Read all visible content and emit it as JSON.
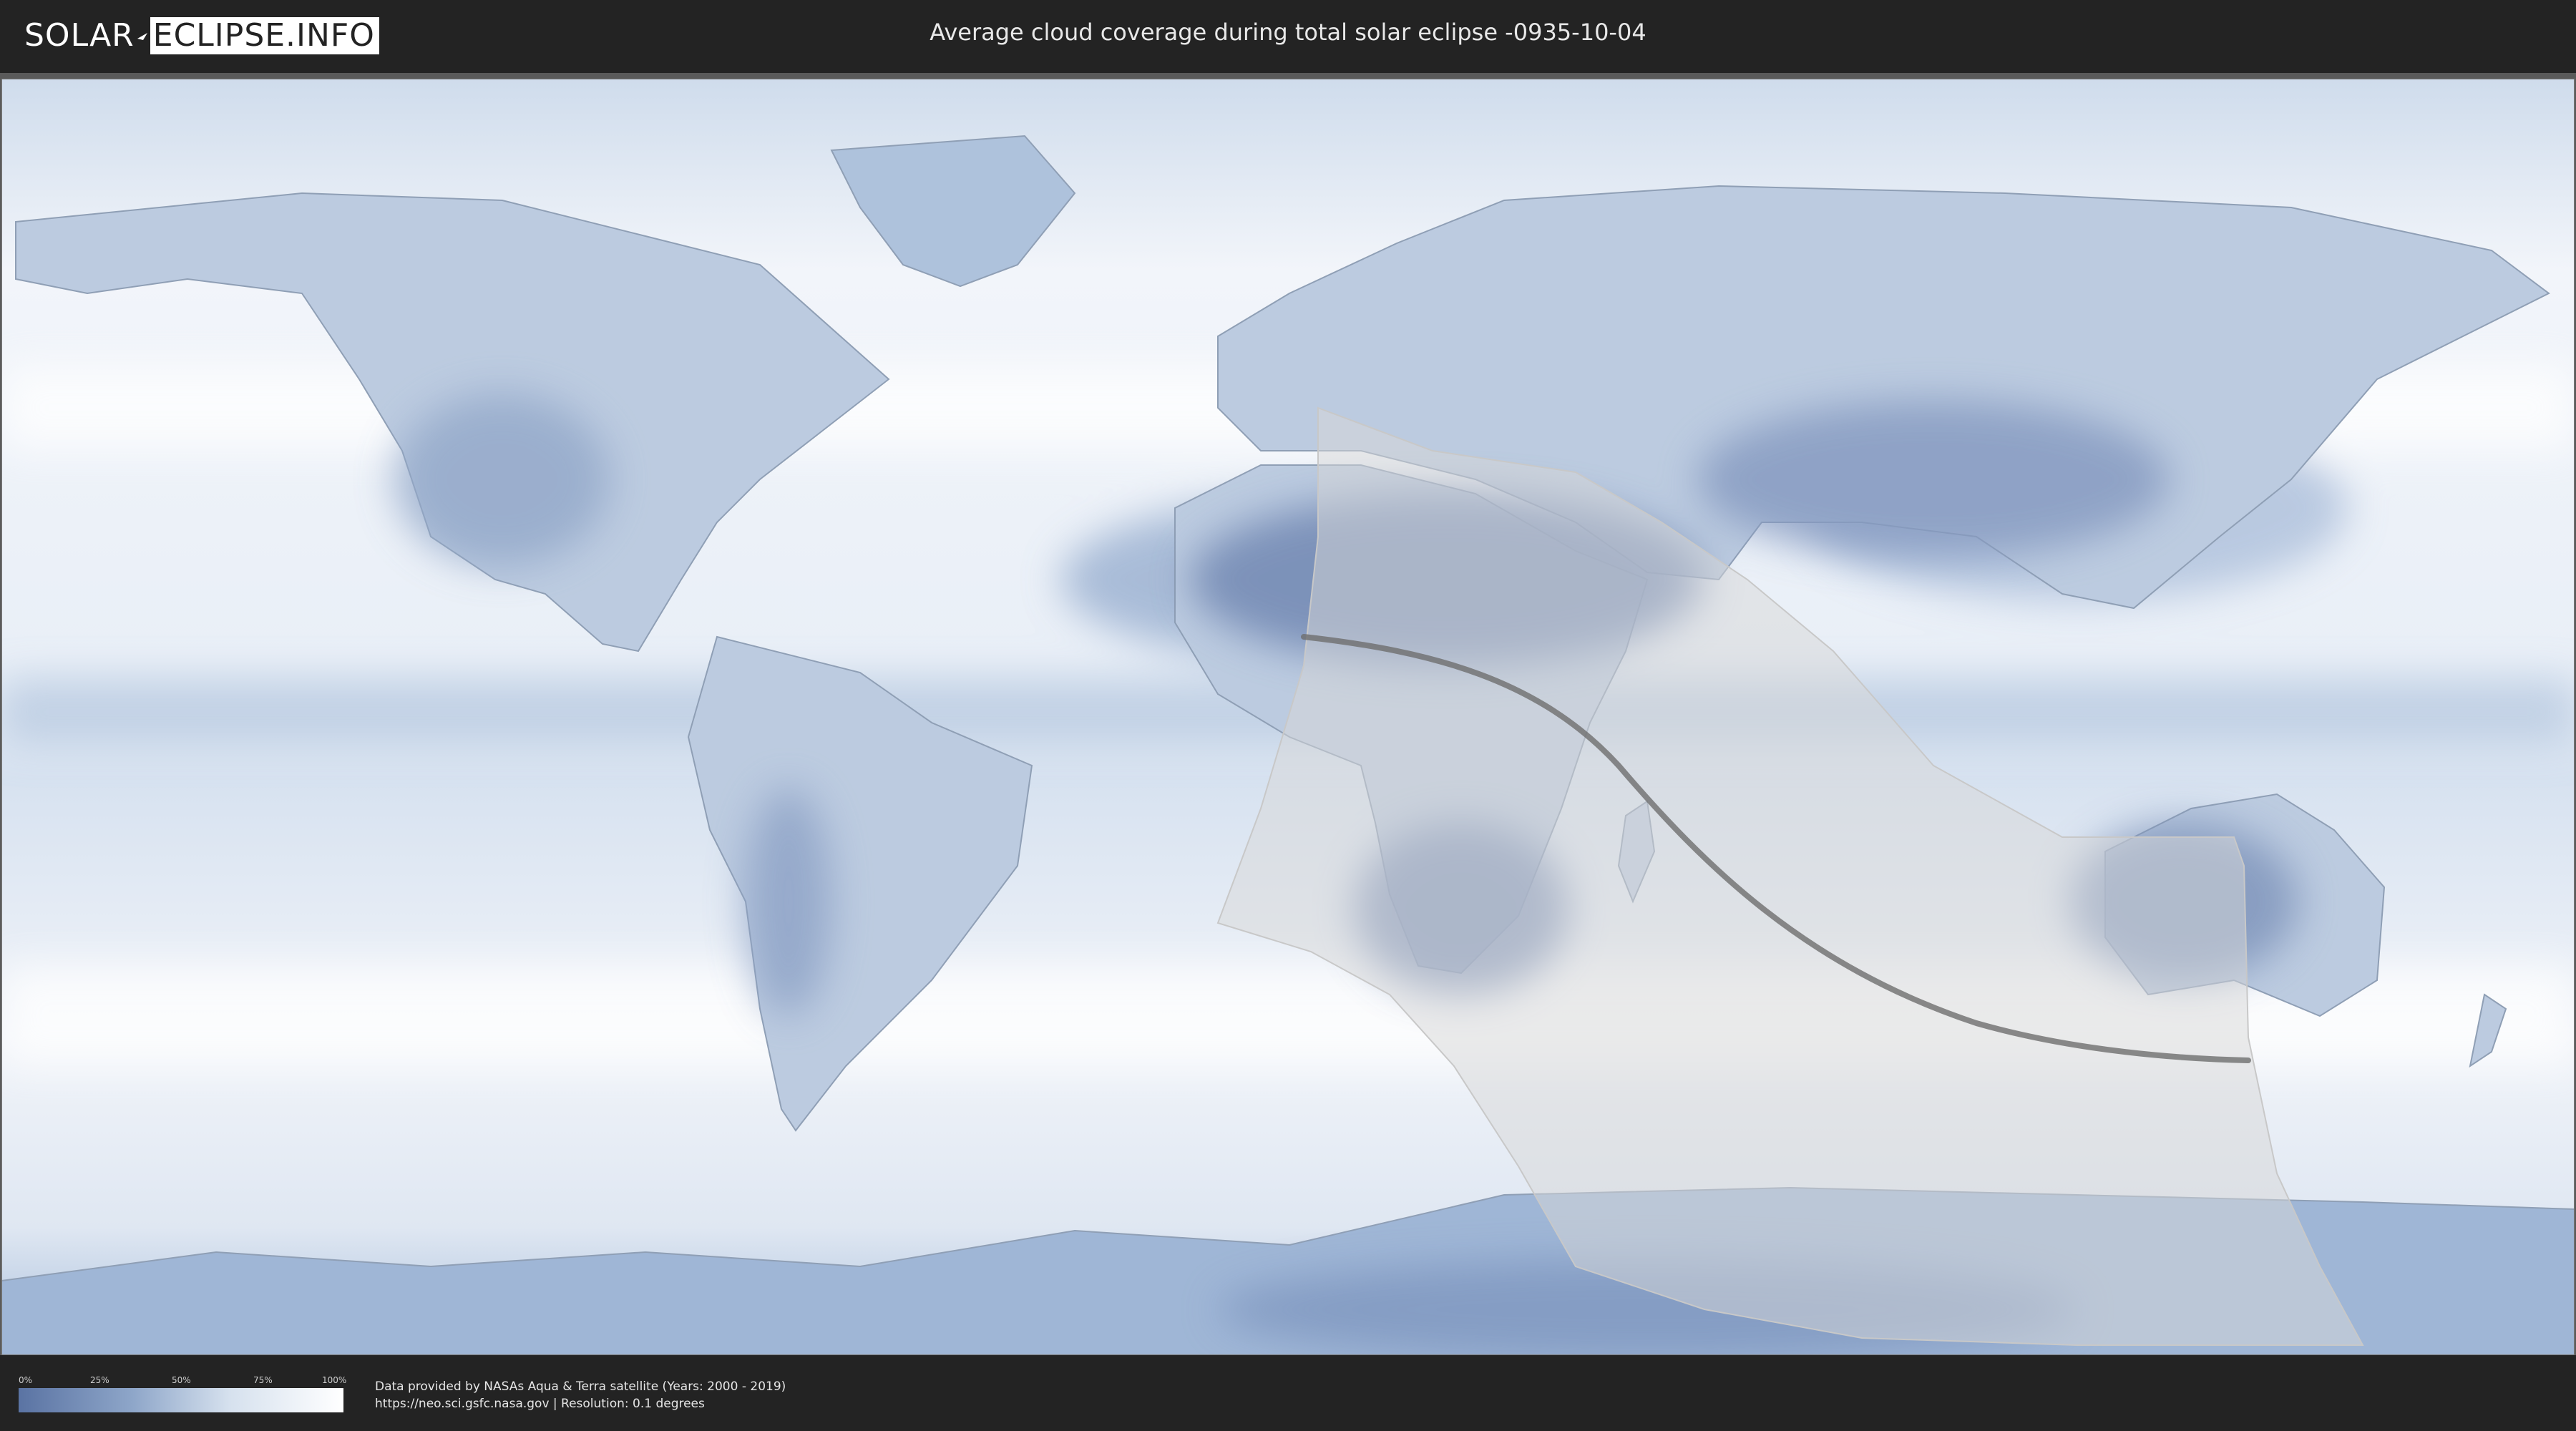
{
  "header": {
    "logo_left": "SOLAR",
    "logo_right": "ECLIPSE.INFO",
    "title": "Average cloud coverage during total solar eclipse -0935-10-04"
  },
  "legend": {
    "ticks": [
      "0%",
      "25%",
      "50%",
      "75%",
      "100%"
    ],
    "low_color": "#5a73a3",
    "high_color": "#ffffff"
  },
  "footer": {
    "credit_line": "Data provided by NASAs Aqua & Terra satellite (Years: 2000 - 2019)",
    "source_line": "https://neo.sci.gsfc.nasa.gov | Resolution: 0.1 degrees"
  },
  "map": {
    "ocean_color": "#e4ebf4",
    "land_color": "#b9c9df",
    "eclipse_zone_color": "#d8d8d8",
    "central_line_color": "#6e6e6e"
  }
}
